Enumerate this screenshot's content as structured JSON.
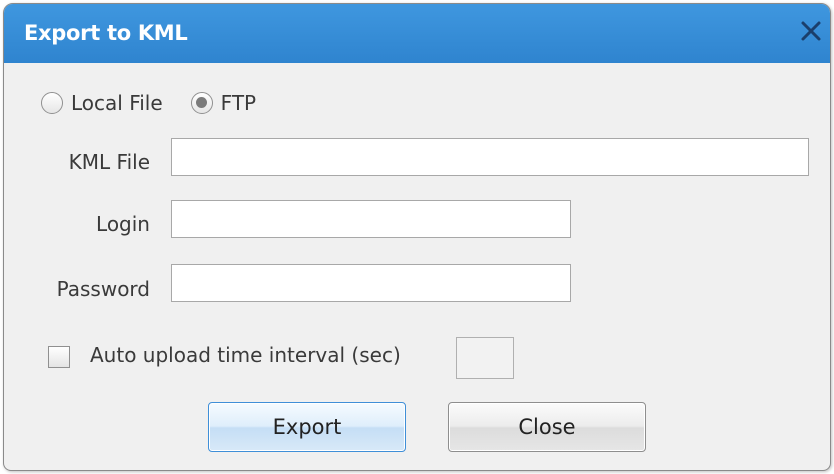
{
  "window": {
    "title": "Export to KML",
    "close_icon": "close-icon"
  },
  "export_target": {
    "options": [
      {
        "label": "Local File",
        "selected": false
      },
      {
        "label": "FTP",
        "selected": true
      }
    ]
  },
  "fields": {
    "kml_file": {
      "label": "KML File",
      "value": ""
    },
    "login": {
      "label": "Login",
      "value": ""
    },
    "password": {
      "label": "Password",
      "value": ""
    }
  },
  "auto_upload": {
    "label": "Auto upload time interval (sec)",
    "checked": false,
    "interval_value": ""
  },
  "buttons": {
    "export_label": "Export",
    "close_label": "Close"
  },
  "colors": {
    "titlebar": "#3a91da",
    "title_text": "#ffffff",
    "dialog_bg": "#f0f0f0",
    "focused_button_border": "#3f8fd8"
  }
}
